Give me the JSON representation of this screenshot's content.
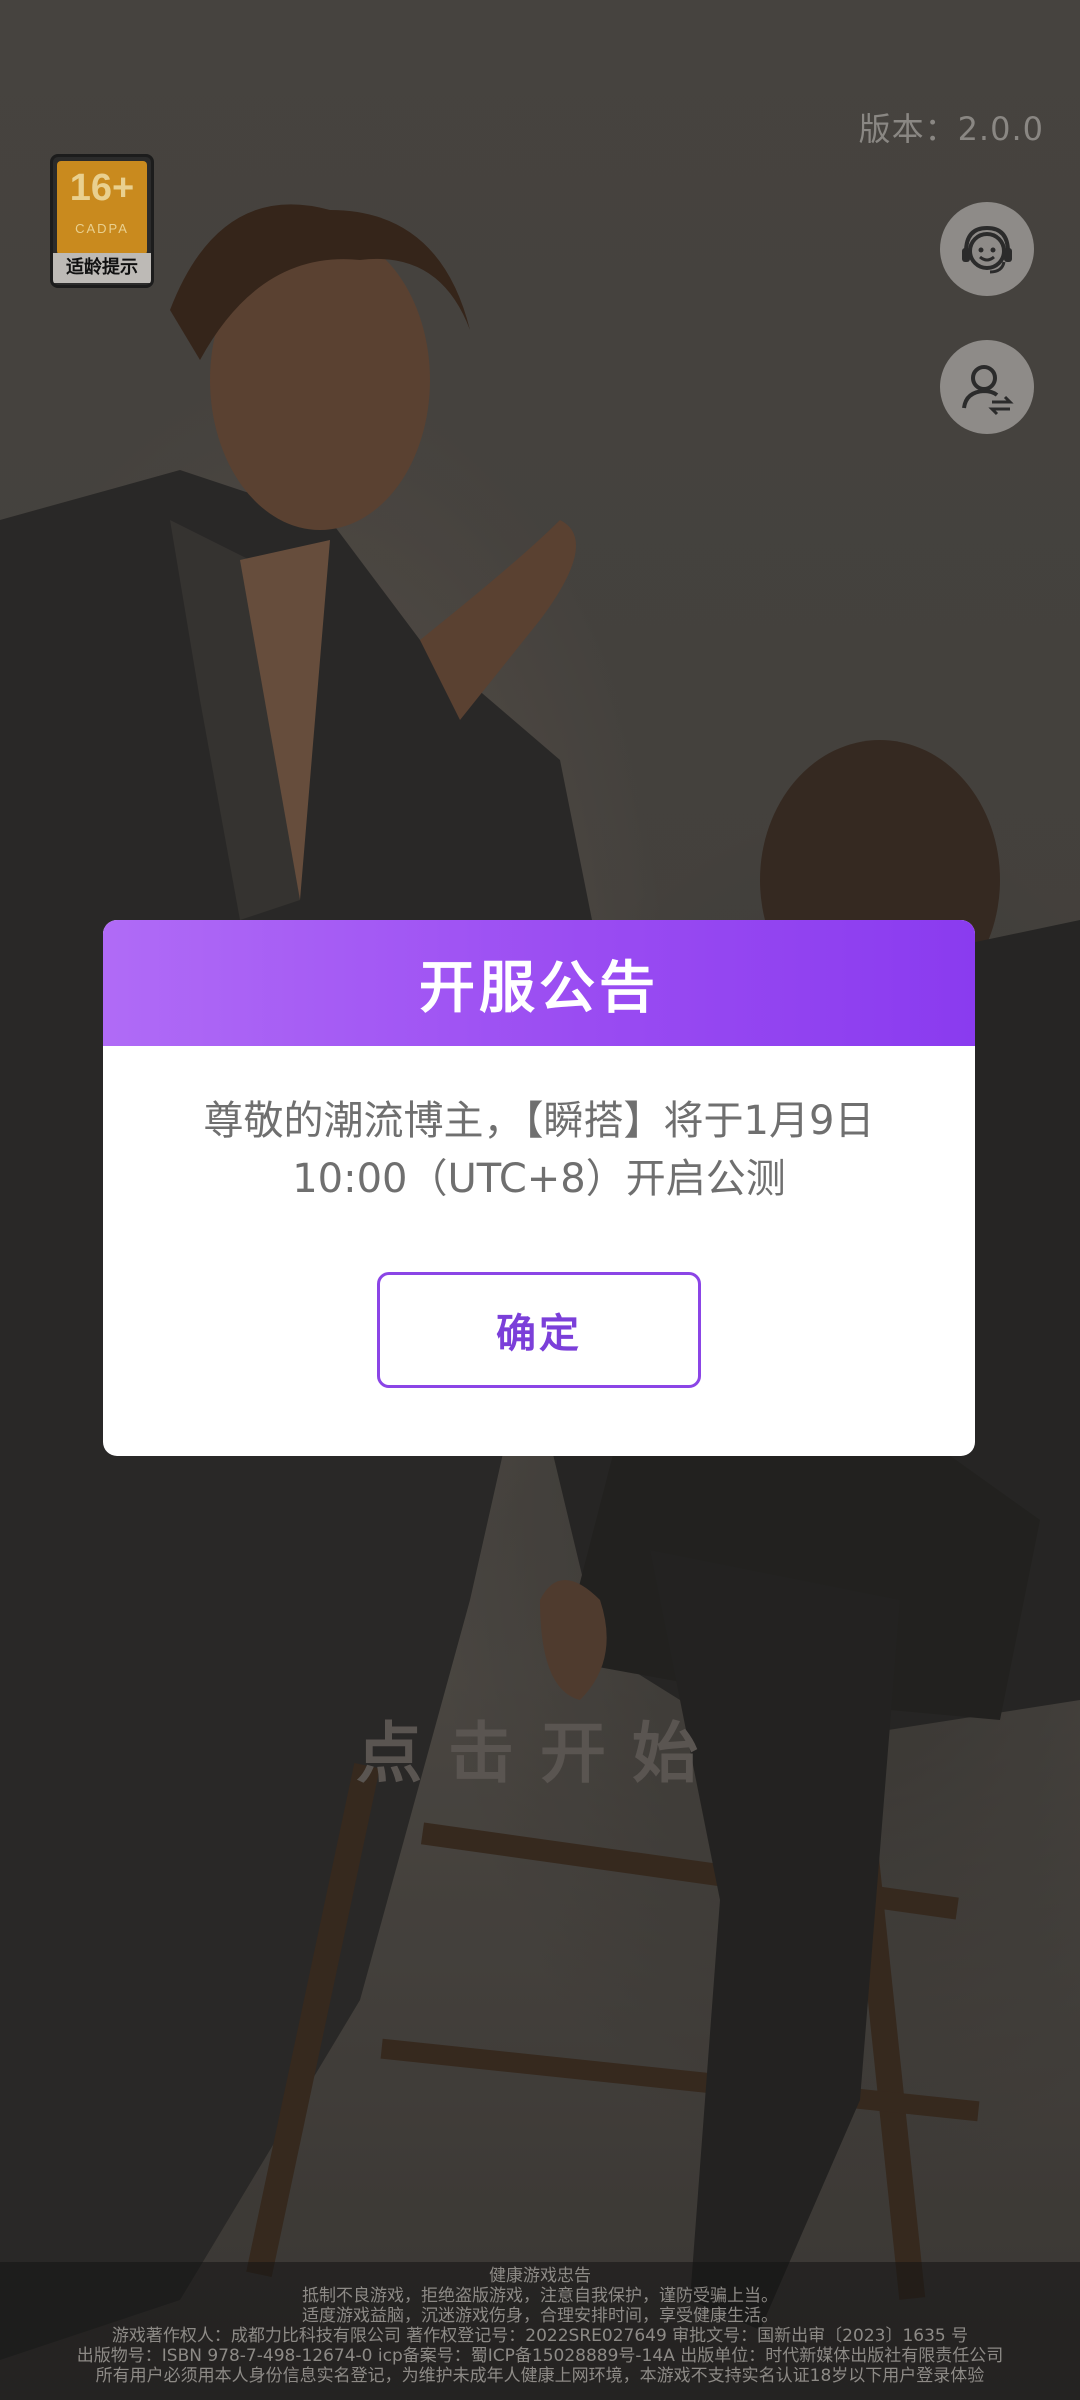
{
  "version_text": "版本：2.0.0",
  "age_badge": {
    "rating": "16+",
    "org": "CADPA",
    "label": "适龄提示"
  },
  "side_buttons": [
    {
      "icon": "customer-service-icon"
    },
    {
      "icon": "switch-account-icon"
    }
  ],
  "start_text": "点击开始",
  "dialog": {
    "title": "开服公告",
    "message_line1": "尊敬的潮流博主，【瞬搭】将于1月9日",
    "message_line2": "10:00（UTC+8）开启公测",
    "confirm_label": "确定"
  },
  "footer": {
    "line1": "健康游戏忠告",
    "line2": "抵制不良游戏，拒绝盗版游戏，注意自我保护，谨防受骗上当。",
    "line3": "适度游戏益脑，沉迷游戏伤身，合理安排时间，享受健康生活。",
    "line4": "游戏著作权人：成都力比科技有限公司 著作权登记号：2022SRE027649 审批文号：国新出审〔2023〕1635 号",
    "line5": "出版物号：ISBN 978-7-498-12674-0 icp备案号：蜀ICP备15028889号-14A 出版单位：时代新媒体出版社有限责任公司",
    "line6": "所有用户必须用本人身份信息实名登记，为维护未成年人健康上网环境，本游戏不支持实名认证18岁以下用户登录体验"
  },
  "colors": {
    "accent": "#9a4cf2",
    "confirm_text": "#7b3fd9"
  }
}
